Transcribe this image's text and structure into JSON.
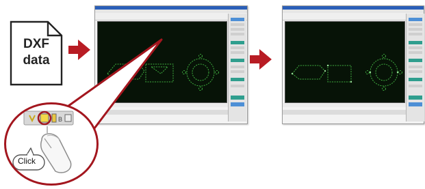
{
  "source_label": {
    "line1": "DXF",
    "line2": "data"
  },
  "click_label": "Click",
  "icons": [
    "document-icon",
    "arrow-right-icon",
    "mouse-icon",
    "toolbar-icon"
  ],
  "colors": {
    "arrow": "#b81c24",
    "callout": "#a3161e",
    "canvas": "#071307",
    "drawing": "#3fae3f"
  }
}
